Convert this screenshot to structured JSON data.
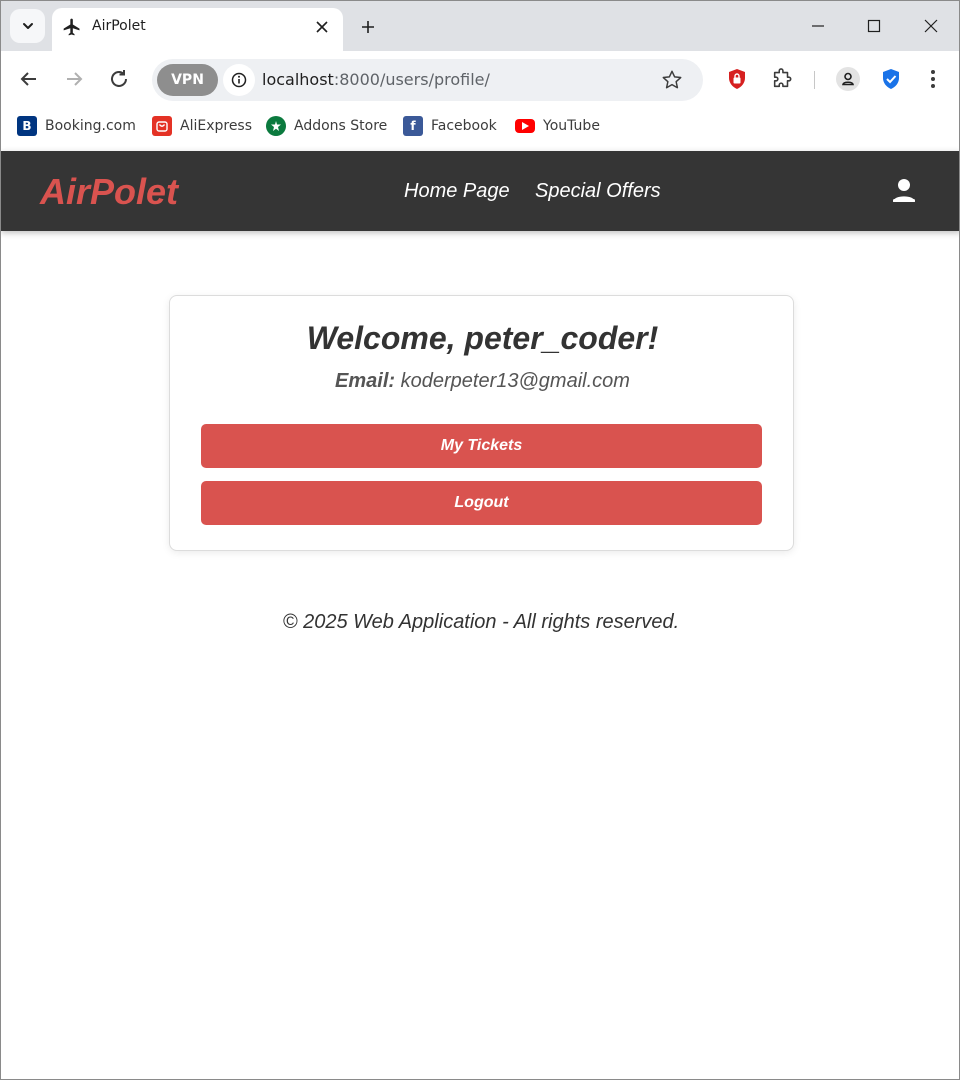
{
  "browser": {
    "tab": {
      "title": "AirPolet"
    },
    "url": {
      "host": "localhost",
      "path": ":8000/users/profile/"
    },
    "vpn_label": "VPN",
    "bookmarks": [
      {
        "label": "Booking.com",
        "icon": "booking-icon",
        "color": "#003580",
        "glyph": "B"
      },
      {
        "label": "AliExpress",
        "icon": "aliexpress-icon",
        "color": "#e43225",
        "glyph": ""
      },
      {
        "label": "Addons Store",
        "icon": "addons-store-icon",
        "color": "#0b7a3e",
        "glyph": ""
      },
      {
        "label": "Facebook",
        "icon": "facebook-icon",
        "color": "#3b5998",
        "glyph": "f"
      },
      {
        "label": "YouTube",
        "icon": "youtube-icon",
        "color": "#ff0000",
        "glyph": ""
      }
    ]
  },
  "site": {
    "brand": "AirPolet",
    "nav": {
      "home": "Home Page",
      "offers": "Special Offers"
    },
    "colors": {
      "accent": "#d9534f",
      "navbar": "#353535"
    }
  },
  "profile": {
    "welcome": "Welcome, peter_coder!",
    "email_label": "Email:",
    "email": "koderpeter13@gmail.com",
    "my_tickets": "My Tickets",
    "logout": "Logout"
  },
  "footer": {
    "text": "© 2025 Web Application - All rights reserved."
  }
}
